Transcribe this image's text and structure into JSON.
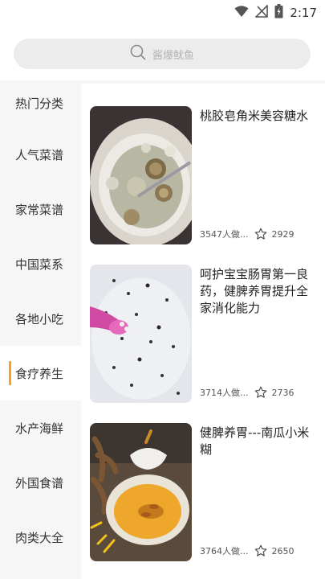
{
  "status_bar": {
    "time": "2:17"
  },
  "search": {
    "placeholder": "酱爆鱿鱼"
  },
  "sidebar": {
    "items": [
      {
        "label": "热门分类"
      },
      {
        "label": "人气菜谱"
      },
      {
        "label": "家常菜谱"
      },
      {
        "label": "中国菜系"
      },
      {
        "label": "各地小吃"
      },
      {
        "label": "食疗养生",
        "active": true
      },
      {
        "label": "水产海鲜"
      },
      {
        "label": "外国食谱"
      },
      {
        "label": "肉类大全"
      }
    ]
  },
  "recipes": [
    {
      "title": "桃胶皂角米美容糖水",
      "views": "3547人做...",
      "stars": "2929"
    },
    {
      "title": "呵护宝宝肠胃第一良药，健脾养胃提升全家消化能力",
      "views": "3714人做...",
      "stars": "2736"
    },
    {
      "title": "健脾养胃---南瓜小米糊",
      "views": "3764人做...",
      "stars": "2650"
    }
  ],
  "colors": {
    "accent": "#f2a51a",
    "sidebar_bg": "#f6f6f6",
    "search_bg": "#ececec"
  }
}
